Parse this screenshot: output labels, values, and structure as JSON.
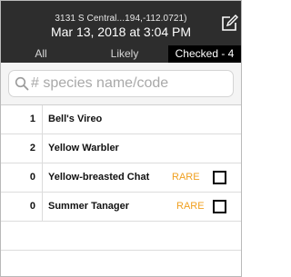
{
  "header": {
    "location": "3131 S Central...194,-112.0721)",
    "datetime": "Mar 13, 2018 at 3:04 PM"
  },
  "tabs": [
    {
      "label": "All"
    },
    {
      "label": "Likely"
    },
    {
      "label": "Checked - 4",
      "selected": true
    }
  ],
  "search": {
    "placeholder": "# species name/code",
    "value": ""
  },
  "species": [
    {
      "count": "1",
      "name": "Bell's Vireo"
    },
    {
      "count": "2",
      "name": "Yellow Warbler"
    },
    {
      "count": "0",
      "name": "Yellow-breasted Chat",
      "badge": "RARE"
    },
    {
      "count": "0",
      "name": "Summer Tanager",
      "badge": "RARE"
    }
  ],
  "colors": {
    "header_bg": "#2d2d2d",
    "selected_tab_bg": "#000000",
    "rare_badge": "#f0a020"
  },
  "icons": {
    "edit": "compose-icon",
    "search": "search-icon",
    "checkbox": "checkbox-icon"
  }
}
